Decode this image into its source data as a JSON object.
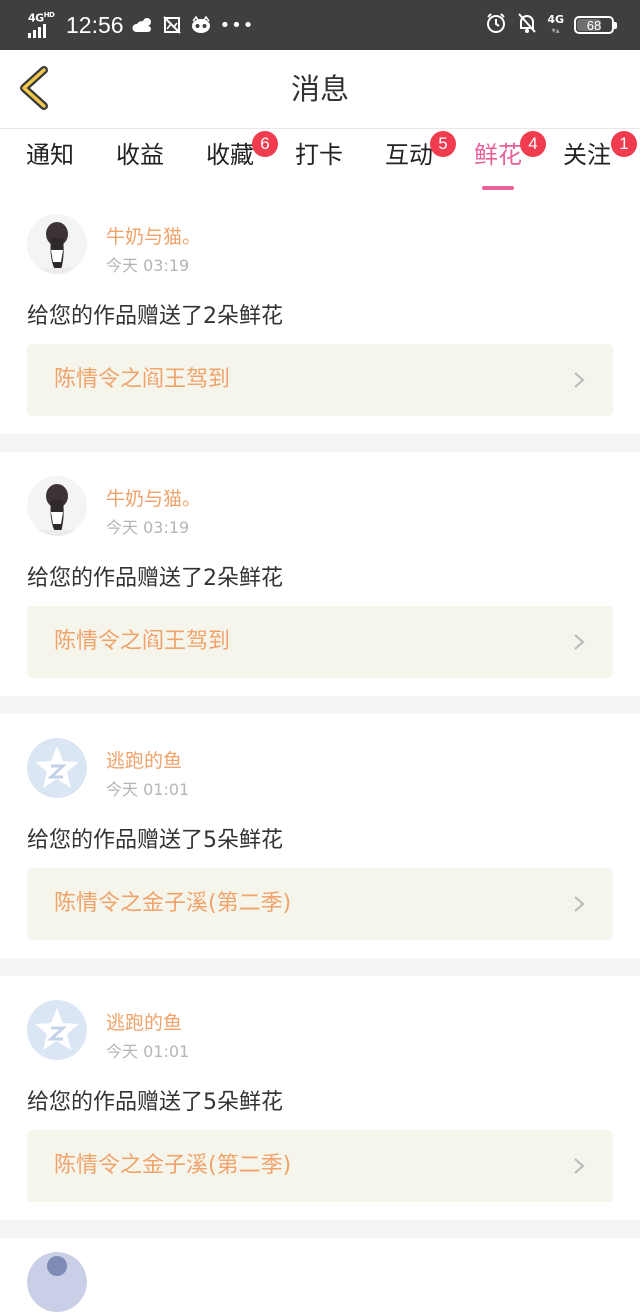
{
  "status_bar": {
    "network": "4G",
    "network_sup": "HD",
    "time": "12:56",
    "network_right": "4G",
    "battery": "68"
  },
  "header": {
    "title": "消息"
  },
  "tabs": [
    {
      "label": "通知",
      "badge": ""
    },
    {
      "label": "收益",
      "badge": ""
    },
    {
      "label": "收藏",
      "badge": "6"
    },
    {
      "label": "打卡",
      "badge": ""
    },
    {
      "label": "互动",
      "badge": "5"
    },
    {
      "label": "鲜花",
      "badge": "4"
    },
    {
      "label": "关注",
      "badge": "1"
    }
  ],
  "active_tab": "鲜花",
  "colors": {
    "accent": "#e8619a",
    "badge": "#f03c4e",
    "username": "#f0a36a",
    "work_bg": "#f5f5ec"
  },
  "messages": [
    {
      "user": "牛奶与猫。",
      "time": "今天 03:19",
      "text": "给您的作品赠送了2朵鲜花",
      "work": "陈情令之阎王驾到",
      "avatar": "girl-photo"
    },
    {
      "user": "牛奶与猫。",
      "time": "今天 03:19",
      "text": "给您的作品赠送了2朵鲜花",
      "work": "陈情令之阎王驾到",
      "avatar": "girl-photo"
    },
    {
      "user": "逃跑的鱼",
      "time": "今天 01:01",
      "text": "给您的作品赠送了5朵鲜花",
      "work": "陈情令之金子溪(第二季)",
      "avatar": "default-z-star"
    },
    {
      "user": "逃跑的鱼",
      "time": "今天 01:01",
      "text": "给您的作品赠送了5朵鲜花",
      "work": "陈情令之金子溪(第二季)",
      "avatar": "default-z-star"
    }
  ]
}
